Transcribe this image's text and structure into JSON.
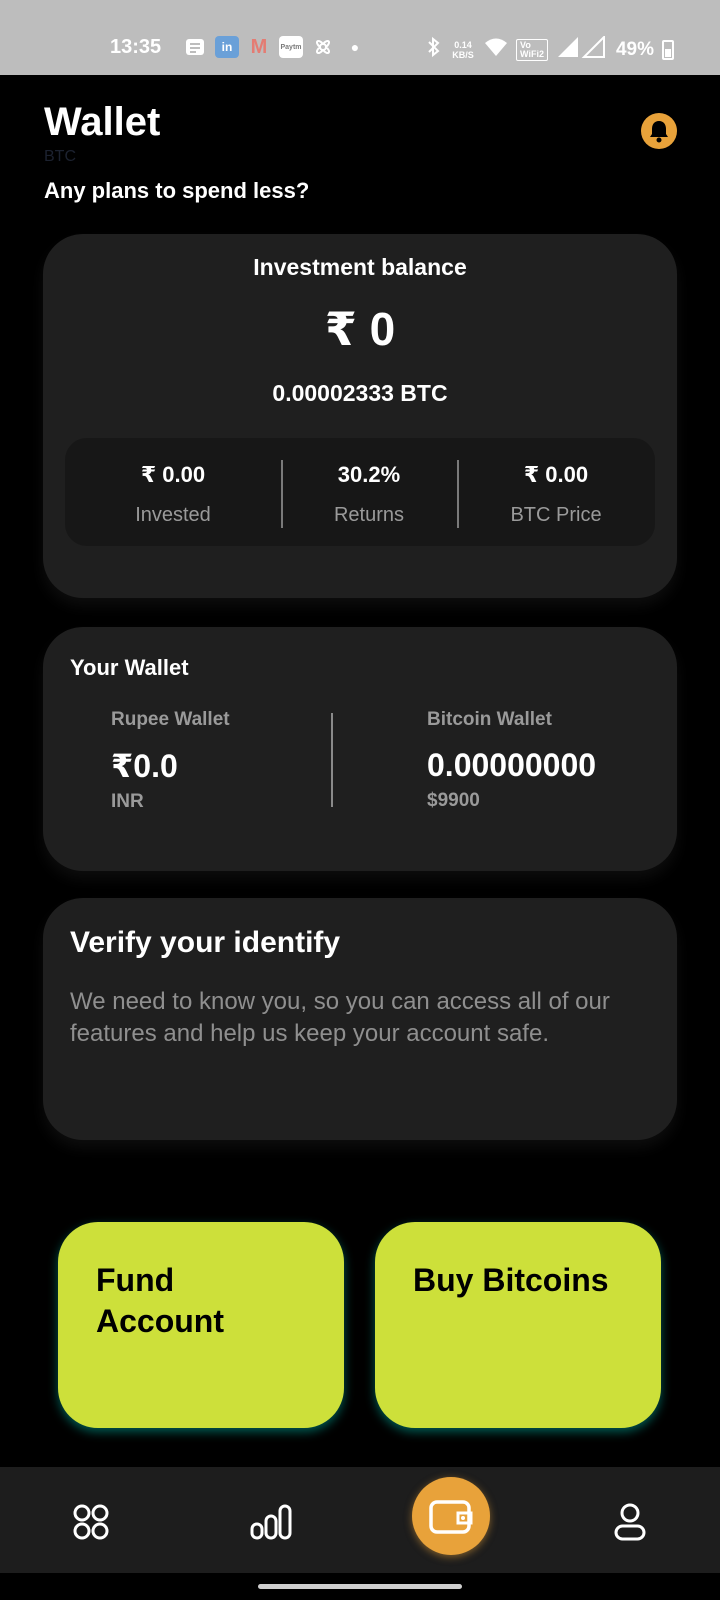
{
  "status_bar": {
    "time": "13:35",
    "network_speed": "0.14 KB/S",
    "battery": "49%",
    "icons": [
      "messages-icon",
      "linkedin-icon",
      "gmail-icon",
      "paytm-icon",
      "pinwheel-icon",
      "bluetooth-icon",
      "wifi-icon",
      "volte-icon",
      "signal-icon",
      "battery-icon"
    ]
  },
  "header": {
    "title": "Wallet",
    "code": "BTC",
    "tagline": "Any plans to spend less?"
  },
  "balance": {
    "label": "Investment balance",
    "value": "₹ 0",
    "btc": "0.00002333 BTC",
    "stats": [
      {
        "value": "₹ 0.00",
        "label": "Invested"
      },
      {
        "value": "30.2%",
        "label": "Returns"
      },
      {
        "value": "₹ 0.00",
        "label": "BTC Price"
      }
    ]
  },
  "wallet": {
    "title": "Your Wallet",
    "rupee": {
      "label": "Rupee Wallet",
      "value": "₹0.0",
      "sub": "INR"
    },
    "bitcoin": {
      "label": "Bitcoin Wallet",
      "value": "0.00000000",
      "sub": "$9900"
    }
  },
  "verify": {
    "title": "Verify your identify",
    "text": "We need to know you, so you can access all of our features and help us keep your account safe."
  },
  "actions": {
    "fund_line1": "Fund",
    "fund_line2": "Account",
    "buy": "Buy Bitcoins"
  },
  "colors": {
    "accent": "#cde03a",
    "orange": "#e8a23a",
    "card": "#1f1f1f",
    "background": "#000000"
  },
  "nav": [
    "home-grid-icon",
    "stats-icon",
    "wallet-icon",
    "profile-icon"
  ]
}
